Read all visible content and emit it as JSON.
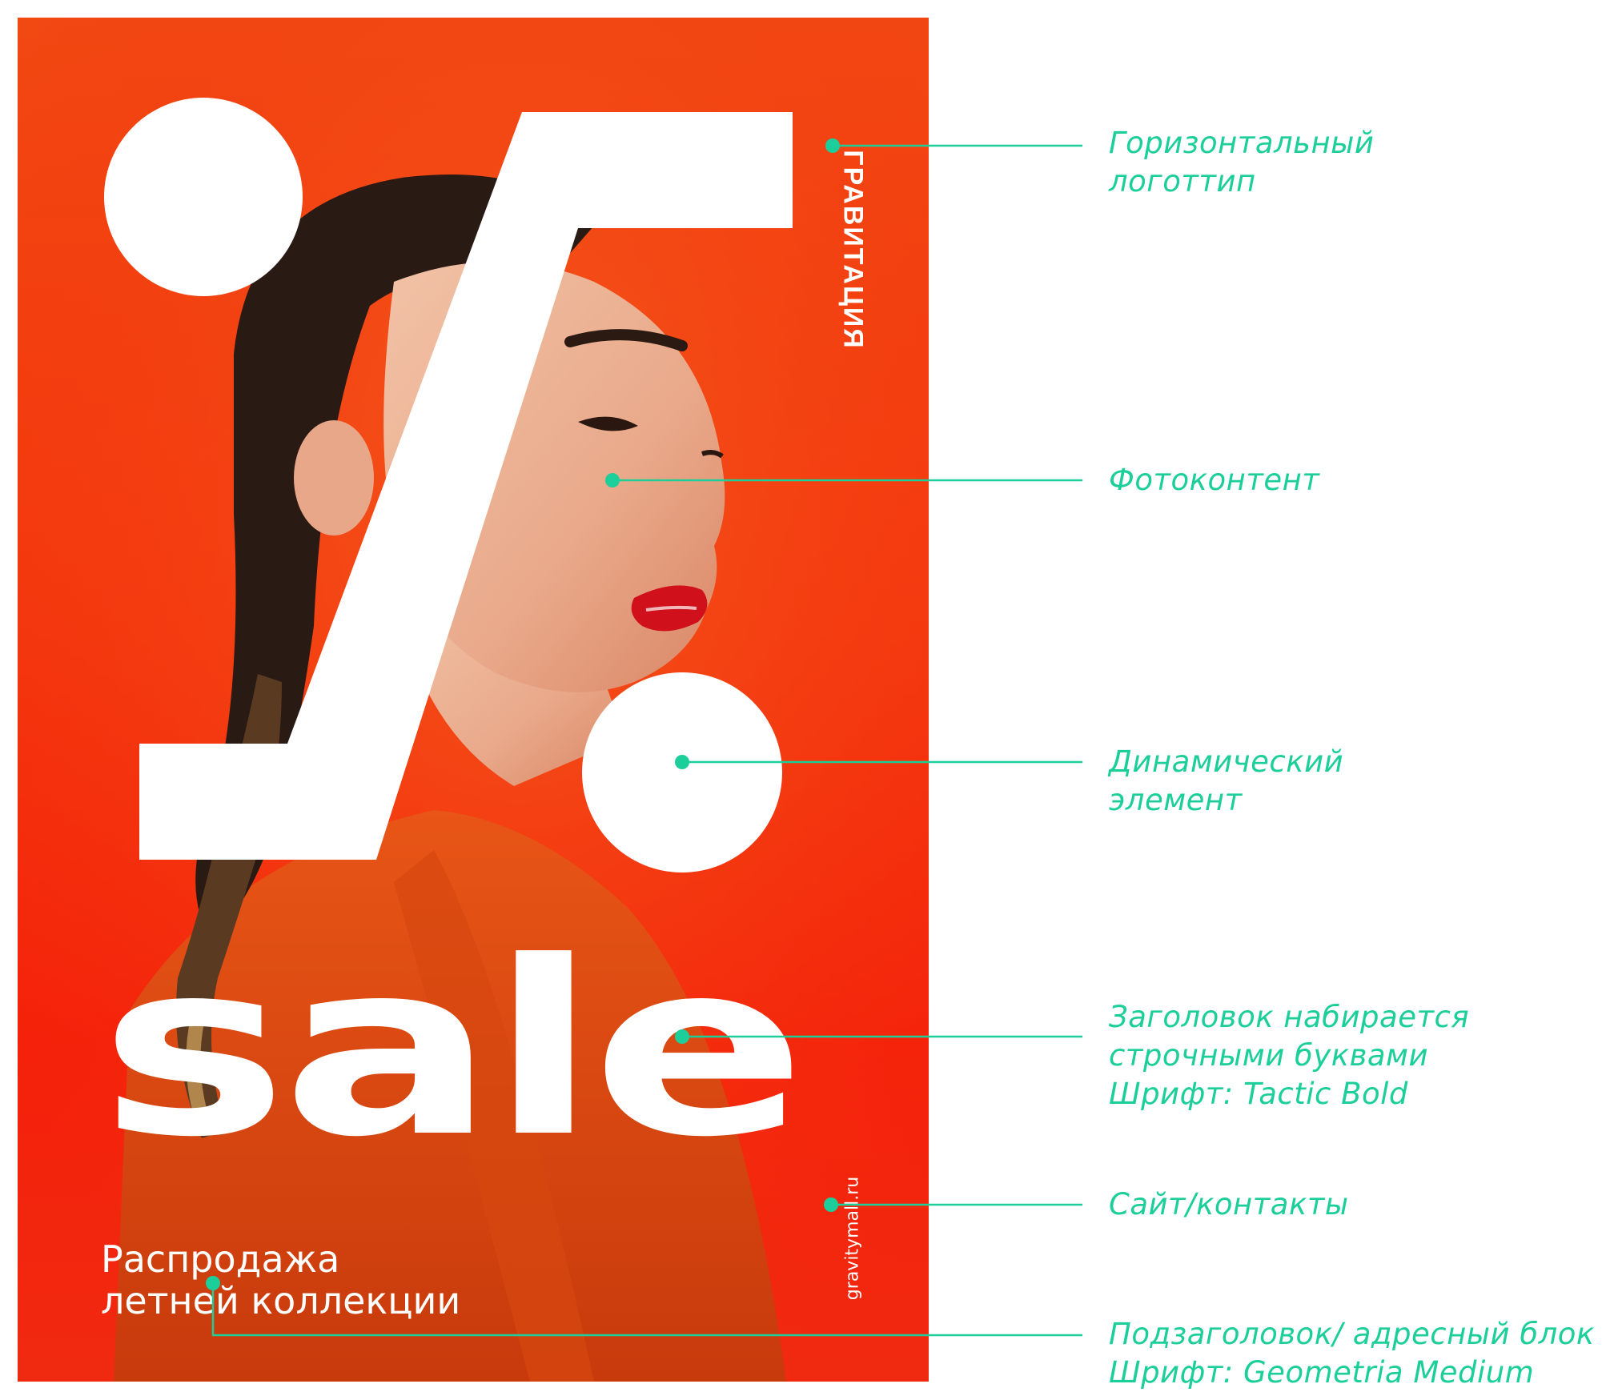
{
  "poster": {
    "logo_text": "ГРАВИТАЦИЯ",
    "headline": "sale",
    "subtitle_line1": "Распродажа",
    "subtitle_line2": "летней коллекции",
    "website": "gravitymall.ru",
    "background_color": "#f23a10",
    "shape_color": "#ffffff"
  },
  "annotations": [
    {
      "lines": [
        "Горизонтальный",
        "логоттип"
      ]
    },
    {
      "lines": [
        "Фотоконтент"
      ]
    },
    {
      "lines": [
        "Динамический",
        "элемент"
      ]
    },
    {
      "lines": [
        "Заголовок набирается",
        "строчными буквами",
        "Шрифт: Tactic Bold"
      ]
    },
    {
      "lines": [
        "Сайт/контакты"
      ]
    },
    {
      "lines": [
        "Подзаголовок/ адресный блок",
        "Шрифт: Geometria Medium"
      ]
    }
  ],
  "accent_color": "#1ccf9a"
}
